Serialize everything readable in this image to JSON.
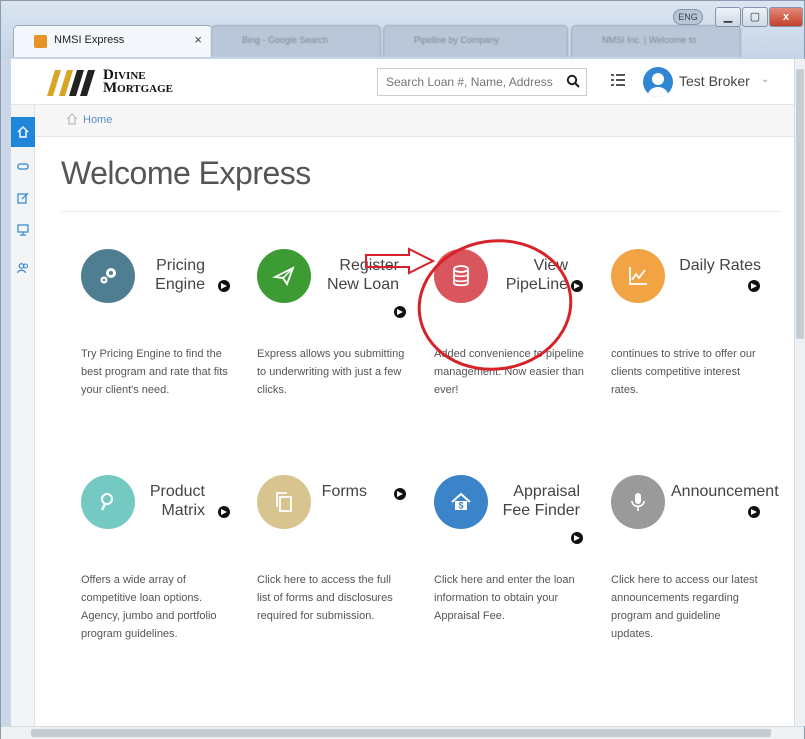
{
  "browser": {
    "active_tab_title": "NMSI Express",
    "inactive_tabs": [
      "Bing - Google Search",
      "Pipeline by Company",
      "NMSI Inc. | Welcome to"
    ],
    "close_glyph": "×",
    "lang_pill": "ENG"
  },
  "header": {
    "logo_line1": "Divine",
    "logo_line2": "Mortgage",
    "search_placeholder": "Search Loan #, Name, Address",
    "user_name": "Test Broker",
    "user_caret": "⌄"
  },
  "breadcrumb": {
    "home": "Home"
  },
  "page_title": "Welcome Express",
  "cards": [
    {
      "title": "Pricing\nEngine",
      "desc": "Try Pricing Engine to find the best program and rate that fits your client's need.",
      "icon": "gears-icon",
      "color": "#4f7e93"
    },
    {
      "title": "Register\nNew Loan",
      "desc": "Express allows you submitting to underwriting with just a few clicks.",
      "icon": "paper-plane-icon",
      "color": "#3c9b33"
    },
    {
      "title": "View\nPipeLine",
      "desc": "Added convenience to pipeline management. Now easier than ever!",
      "icon": "database-icon",
      "color": "#d9565e"
    },
    {
      "title": "Daily Rates",
      "desc": "continues to strive to offer our clients competitive interest rates.",
      "icon": "line-chart-icon",
      "color": "#f2a444"
    },
    {
      "title": "Product\nMatrix",
      "desc": "Offers a wide array of competitive loan options. Agency, jumbo and portfolio program guidelines.",
      "icon": "search-icon",
      "color": "#74cac2"
    },
    {
      "title": "Forms",
      "desc": "Click here to access the full list of forms and disclosures required for submission.",
      "icon": "copy-icon",
      "color": "#d8c48e"
    },
    {
      "title": "Appraisal\nFee Finder",
      "desc": "Click here and enter the loan information to obtain your Appraisal Fee.",
      "icon": "house-dollar-icon",
      "color": "#3c84c9"
    },
    {
      "title": "Announcement",
      "desc": "Click here to access our latest announcements regarding program and guideline updates.",
      "icon": "microphone-icon",
      "color": "#9a9a9a"
    }
  ],
  "colors": {
    "accent_blue": "#1f86d9",
    "annotation_red": "#d8222a"
  }
}
